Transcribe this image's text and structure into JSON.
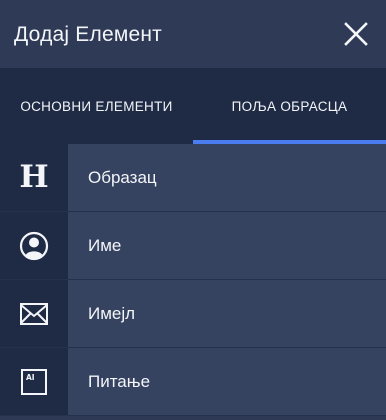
{
  "header": {
    "title": "Додај Елемент",
    "close_icon": "close-icon"
  },
  "tabs": [
    {
      "label": "ОСНОВНИ ЕЛЕМЕНТИ",
      "active": false
    },
    {
      "label": "ПОЉА ОБРАСЦА",
      "active": true
    }
  ],
  "items": [
    {
      "label": "Образац",
      "icon": "heading-icon",
      "glyph": "H"
    },
    {
      "label": "Име",
      "icon": "user-icon"
    },
    {
      "label": "Имејл",
      "icon": "envelope-icon"
    },
    {
      "label": "Питање",
      "icon": "ai-box-icon",
      "glyph": "AI"
    }
  ],
  "colors": {
    "header_bg": "#2f3b56",
    "tabs_bg": "#1f2a45",
    "active_tab_indicator": "#4a7df0",
    "icon_cell_bg": "#1f2a45",
    "label_cell_bg": "#364360",
    "text": "#f3f5f9"
  }
}
